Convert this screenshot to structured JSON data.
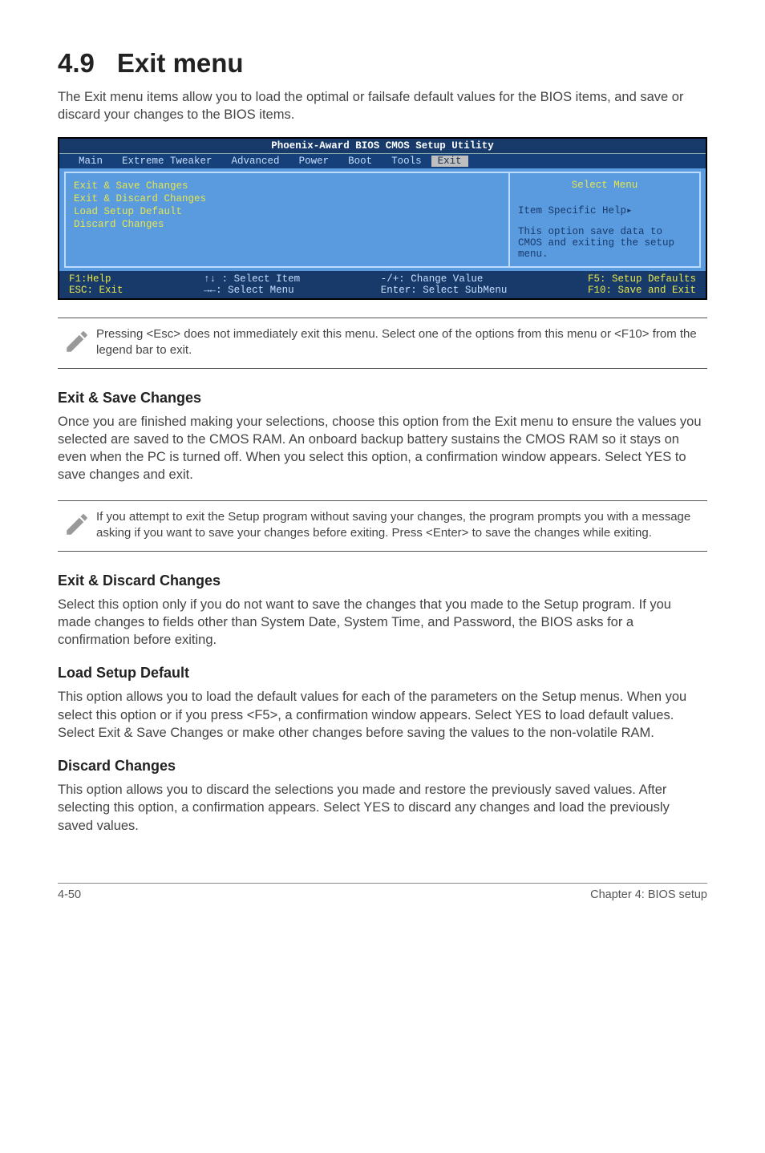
{
  "page": {
    "heading_num": "4.9",
    "heading_text": "Exit menu",
    "intro": "The Exit menu items allow you to load the optimal or failsafe default values for the BIOS items, and save or discard your changes to the BIOS items."
  },
  "bios": {
    "title": "Phoenix-Award BIOS CMOS Setup Utility",
    "menu": [
      "Main",
      "Extreme Tweaker",
      "Advanced",
      "Power",
      "Boot",
      "Tools",
      "Exit"
    ],
    "active_menu": "Exit",
    "left_items": [
      "Exit & Save Changes",
      "Exit & Discard Changes",
      "Load Setup Default",
      "Discard Changes"
    ],
    "right": {
      "title": "Select Menu",
      "help_label": "Item Specific Help▸",
      "help_body": "This option save data to CMOS and exiting the setup menu."
    },
    "footer": {
      "c1a": "F1:Help",
      "c1b": "ESC: Exit",
      "c2a": "↑↓ : Select Item",
      "c2b": "→←: Select Menu",
      "c3a": "-/+: Change Value",
      "c3b": "Enter: Select SubMenu",
      "c4a": "F5: Setup Defaults",
      "c4b": "F10: Save and Exit"
    }
  },
  "note1": "Pressing <Esc> does not immediately exit this menu. Select one of the options from this menu or <F10> from the legend bar to exit.",
  "sec1": {
    "title": "Exit & Save Changes",
    "body": "Once you are finished making your selections, choose this option from the Exit menu to ensure the values you selected are saved to the CMOS RAM. An onboard backup battery sustains the CMOS RAM so it stays on even when the PC is turned off. When you select this option, a confirmation window appears. Select YES to save changes and exit."
  },
  "note2": "If you attempt to exit the Setup program without saving your changes, the program prompts you with a message asking if you want to save your changes before exiting. Press <Enter> to save the changes while exiting.",
  "sec2": {
    "title": "Exit & Discard Changes",
    "body": "Select this option only if you do not want to save the changes that you made to the Setup program. If you made changes to fields other than System Date, System Time, and Password, the BIOS asks for a confirmation before exiting."
  },
  "sec3": {
    "title": "Load Setup Default",
    "body": "This option allows you to load the default values for each of the parameters on the Setup menus. When you select this option or if you press <F5>, a confirmation window appears. Select YES to load default values. Select Exit & Save Changes or make other changes before saving the values to the non-volatile RAM."
  },
  "sec4": {
    "title": "Discard Changes",
    "body": "This option allows you to discard the selections you made and restore the previously saved values. After selecting this option, a confirmation appears. Select YES to discard any changes and load the previously saved values."
  },
  "footer": {
    "left": "4-50",
    "right": "Chapter 4: BIOS setup"
  }
}
